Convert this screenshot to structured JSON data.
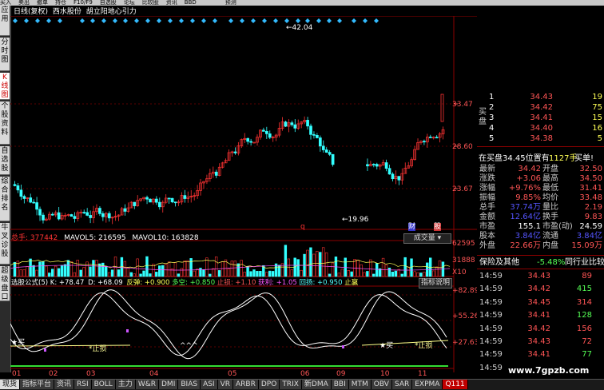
{
  "menu": [
    "买入",
    "卖出",
    "撤单",
    "持仓",
    "F10/F9",
    "自选股",
    "论坛",
    "比较股",
    "资讯",
    "BBD",
    "",
    "",
    "",
    "预测"
  ],
  "sidebar": [
    "应用",
    "分时图",
    "K线图",
    "个股资料",
    "自选股",
    "综合排名",
    "牛叉诊股",
    "超级盘口"
  ],
  "header": {
    "period": "日线(复权)",
    "stock": "西水股份",
    "indicator": "胡立阳地心引力"
  },
  "price_axis": [
    "33.47",
    "28.60",
    "23.67"
  ],
  "price_annotations": {
    "high": "42.04",
    "low": "19.96"
  },
  "chart_marks": {
    "q": "q",
    "cai": "财",
    "gu": "股"
  },
  "volume_header": {
    "total": "总手: 377442",
    "ma5": "MAVOL5: 216595",
    "ma10": "MAVOL10: 163828",
    "dropdown": "成交量"
  },
  "volume_axis": [
    "62595",
    "31888",
    "X10"
  ],
  "indicator_header": {
    "name": "选股公式(5)",
    "k": "K: +78.47",
    "d": "D: +68.09",
    "fantan": "反弹: +0.900",
    "duokong": "多空: +0.850",
    "zhisun": "止损: +1.10",
    "huoli": "获利: +1.05",
    "huiyang": "回扬: +0.950",
    "zhiying": "止赢",
    "help": "指标说明"
  },
  "indicator_axis": [
    "+82.89",
    "+55.26",
    "+27.63"
  ],
  "indicator_labels": {
    "buy1": "买",
    "stop1": "*止损",
    "dots": "^^^",
    "buy2": "买",
    "stop2": "*止损"
  },
  "time_axis": [
    "01",
    "02",
    "03",
    "04",
    "05",
    "06",
    "09",
    "10",
    "11"
  ],
  "order_book": {
    "sell": [
      {
        "level": "5",
        "price": "",
        "vol": ""
      }
    ],
    "buy_label": "买盘",
    "buy": [
      {
        "level": "1",
        "price": "34.43",
        "vol": "19"
      },
      {
        "level": "2",
        "price": "34.42",
        "vol": "75"
      },
      {
        "level": "3",
        "price": "34.41",
        "vol": "15"
      },
      {
        "level": "4",
        "price": "34.40",
        "vol": "16"
      },
      {
        "level": "5",
        "price": "34.38",
        "vol": "5"
      }
    ]
  },
  "order_summary": {
    "left": "在买盘34.45位置有",
    "mid": "1127手",
    "right": "买单!",
    "link": "查看详细"
  },
  "quote": [
    {
      "l": "最新",
      "lv": "34.42",
      "r": "开盘",
      "rv": "32.50"
    },
    {
      "l": "涨跌",
      "lv": "+3.06",
      "r": "最高",
      "rv": "34.50"
    },
    {
      "l": "涨幅",
      "lv": "+9.76%",
      "r": "最低",
      "rv": "31.41"
    },
    {
      "l": "振幅",
      "lv": "9.85%",
      "r": "均价",
      "rv": "33.48"
    },
    {
      "l": "总手",
      "lv": "37.74万",
      "r": "量比",
      "rv": "2.19"
    },
    {
      "l": "金额",
      "lv": "12.64亿",
      "r": "换手",
      "rv": "9.83"
    },
    {
      "l": "市盈",
      "lv": "155.1",
      "r": "市盈(动)",
      "rv": "24.59"
    },
    {
      "l": "股本",
      "lv": "3.84亿",
      "r": "流通",
      "rv": "3.84亿"
    },
    {
      "l": "外盘",
      "lv": "22.66万",
      "r": "内盘",
      "rv": "15.09万"
    }
  ],
  "sector": {
    "name": "保险及其他",
    "change": "-5.48%",
    "link": "同行业比较"
  },
  "ticks": [
    {
      "t": "14:59",
      "p": "34.43",
      "v": "89"
    },
    {
      "t": "14:59",
      "p": "34.42",
      "v": "415"
    },
    {
      "t": "14:59",
      "p": "34.45",
      "v": "314"
    },
    {
      "t": "14:59",
      "p": "34.41",
      "v": "128"
    },
    {
      "t": "14:59",
      "p": "34.42",
      "v": "156"
    },
    {
      "t": "14:59",
      "p": "34.43",
      "v": "72"
    },
    {
      "t": "14:59",
      "p": "34.41",
      "v": "77"
    },
    {
      "t": "14:59",
      "p": "",
      "v": ""
    }
  ],
  "tabs": [
    "现货",
    "指标平台",
    "资讯",
    "RSI",
    "BOLL",
    "主力",
    "W&R",
    "DMI",
    "BIAS",
    "ASI",
    "VR",
    "ARBR",
    "DPO",
    "TRIX",
    "新DMA",
    "BBI",
    "MTM",
    "OBV",
    "SAR",
    "EXPMA",
    "Q111"
  ],
  "watermark": "www.7gpzb.com",
  "colors": {
    "up": "#ff3333",
    "down": "#33ffff",
    "accent": "#c00000",
    "yellow": "#ffff55",
    "grid": "#8b0000"
  }
}
